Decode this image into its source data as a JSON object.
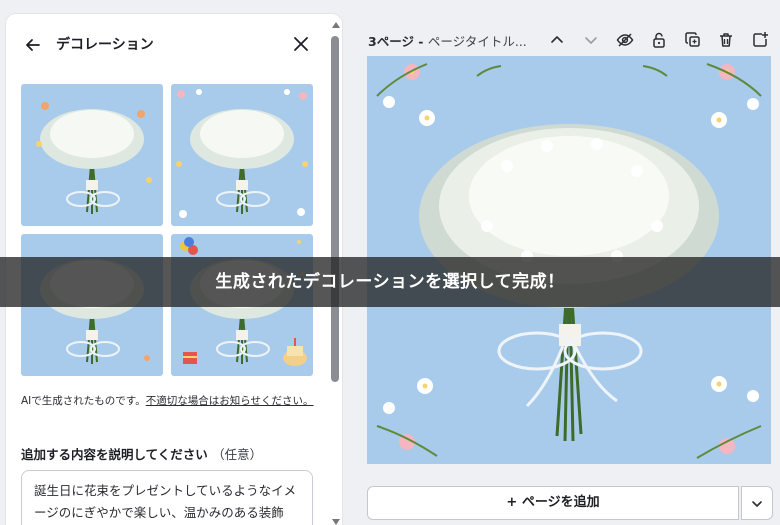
{
  "panel": {
    "title": "デコレーション",
    "back_icon": "arrow-left-icon",
    "close_icon": "close-icon",
    "thumbnails": [
      {
        "label": "decoration-option-1"
      },
      {
        "label": "decoration-option-2"
      },
      {
        "label": "decoration-option-3"
      },
      {
        "label": "decoration-option-4"
      }
    ],
    "ai_note_prefix": "AIで生成されたものです。",
    "ai_note_link": "不適切な場合はお知らせください。",
    "description_label": "追加する内容を説明してください",
    "description_optional": "（任意）",
    "description_value": "誕生日に花束をプレゼントしているようなイメージのにぎやかで楽しい、温かみのある装飾"
  },
  "editor": {
    "page_number": "3ページ - ",
    "page_title": "ページタイトル...",
    "toolbar_icons": [
      "chevron-up-icon",
      "chevron-down-icon",
      "eye-icon",
      "lock-icon",
      "duplicate-icon",
      "trash-icon",
      "add-page-icon"
    ],
    "add_page_label": "+ ページを追加",
    "more_icon": "chevron-down-icon"
  },
  "banner": {
    "text": "生成されたデコレーションを選択して完成！"
  },
  "colors": {
    "background": "#eef0f3",
    "image_blue": "#a9cbeb",
    "banner": "#262626"
  }
}
